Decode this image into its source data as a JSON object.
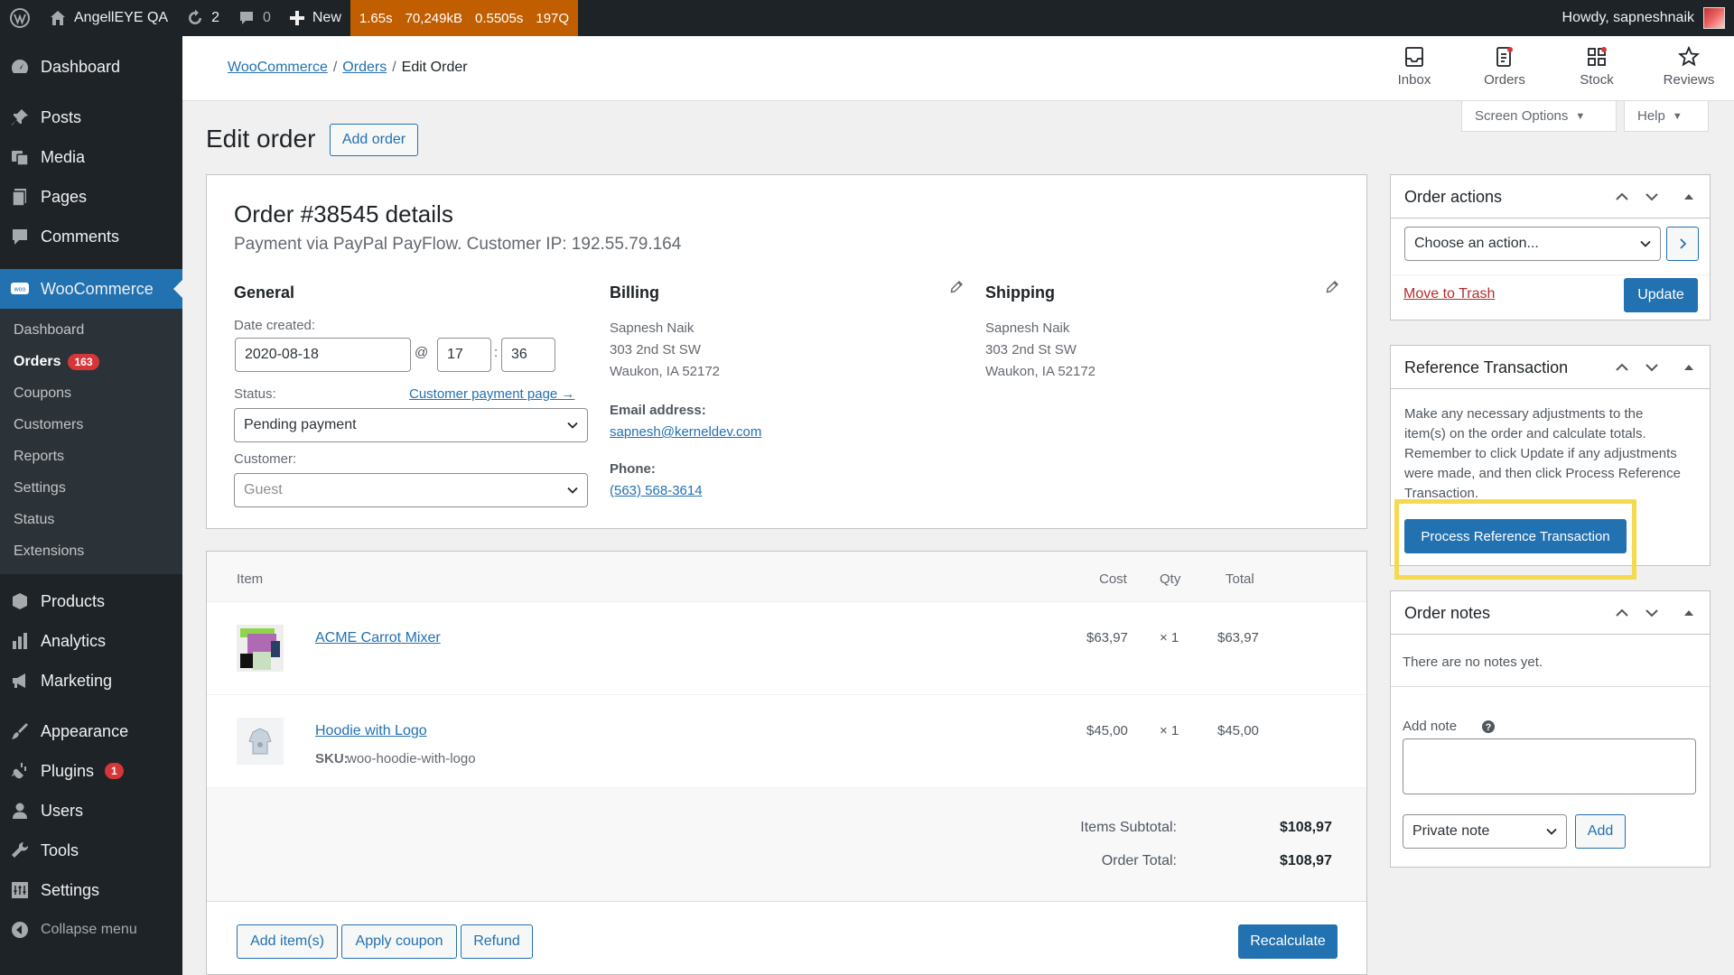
{
  "adminbar": {
    "site_name": "AngellEYE QA",
    "updates_count": "2",
    "comments_count": "0",
    "new_label": "New",
    "qm": [
      "1.65s",
      "70,249kB",
      "0.5505s",
      "197Q"
    ],
    "howdy": "Howdy, sapneshnaik"
  },
  "sidebar": {
    "items_top": [
      {
        "label": "Dashboard",
        "icon": "dashboard-icon"
      },
      {
        "label": "Posts",
        "icon": "pin-icon"
      },
      {
        "label": "Media",
        "icon": "media-icon"
      },
      {
        "label": "Pages",
        "icon": "pages-icon"
      },
      {
        "label": "Comments",
        "icon": "comment-icon"
      }
    ],
    "woocommerce": "WooCommerce",
    "submenu": [
      "Dashboard",
      "Orders",
      "Coupons",
      "Customers",
      "Reports",
      "Settings",
      "Status",
      "Extensions"
    ],
    "orders_badge": "163",
    "items_bottom": [
      {
        "label": "Products",
        "icon": "products-icon"
      },
      {
        "label": "Analytics",
        "icon": "analytics-icon"
      },
      {
        "label": "Marketing",
        "icon": "megaphone-icon"
      },
      {
        "label": "Appearance",
        "icon": "brush-icon"
      },
      {
        "label": "Plugins",
        "icon": "plug-icon"
      },
      {
        "label": "Users",
        "icon": "users-icon"
      },
      {
        "label": "Tools",
        "icon": "wrench-icon"
      },
      {
        "label": "Settings",
        "icon": "settings-icon"
      }
    ],
    "plugins_badge": "1",
    "collapse": "Collapse menu"
  },
  "header": {
    "breadcrumb": [
      "WooCommerce",
      "Orders",
      "Edit Order"
    ],
    "activity": [
      "Inbox",
      "Orders",
      "Stock",
      "Reviews"
    ],
    "screen_options": "Screen Options",
    "help": "Help"
  },
  "page": {
    "title": "Edit order",
    "add_order": "Add order"
  },
  "order": {
    "heading": "Order #38545 details",
    "subheading": "Payment via PayPal PayFlow. Customer IP: 192.55.79.164",
    "general": "General",
    "date_label": "Date created:",
    "date": "2020-08-18",
    "at": "@",
    "hour": "17",
    "colon": ":",
    "minute": "36",
    "status_label": "Status:",
    "customer_payment_link": "Customer payment page →",
    "status": "Pending payment",
    "customer_label": "Customer:",
    "customer": "Guest",
    "billing": {
      "title": "Billing",
      "name": "Sapnesh Naik",
      "street": "303 2nd St SW",
      "city": "Waukon, IA 52172",
      "email_label": "Email address:",
      "email": "sapnesh@kerneldev.com",
      "phone_label": "Phone:",
      "phone": "(563) 568-3614"
    },
    "shipping": {
      "title": "Shipping",
      "name": "Sapnesh Naik",
      "street": "303 2nd St SW",
      "city": "Waukon, IA 52172"
    }
  },
  "items": {
    "headers": {
      "item": "Item",
      "cost": "Cost",
      "qty": "Qty",
      "total": "Total"
    },
    "rows": [
      {
        "name": "ACME Carrot Mixer",
        "cost": "$63,97",
        "qty": "× 1",
        "total": "$63,97",
        "sku": ""
      },
      {
        "name": "Hoodie with Logo",
        "cost": "$45,00",
        "qty": "× 1",
        "total": "$45,00",
        "sku_label": "SKU:",
        "sku": "woo-hoodie-with-logo"
      }
    ],
    "subtotal_label": "Items Subtotal:",
    "subtotal": "$108,97",
    "total_label": "Order Total:",
    "total": "$108,97",
    "buttons": {
      "add_items": "Add item(s)",
      "apply_coupon": "Apply coupon",
      "refund": "Refund",
      "recalculate": "Recalculate"
    }
  },
  "order_actions": {
    "title": "Order actions",
    "select": "Choose an action...",
    "trash": "Move to Trash",
    "update": "Update"
  },
  "reference": {
    "title": "Reference Transaction",
    "text": "Make any necessary adjustments to the item(s) on the order and calculate totals. Remember to click Update if any adjustments were made, and then click Process Reference Transaction.",
    "button": "Process Reference Transaction"
  },
  "notes": {
    "title": "Order notes",
    "empty": "There are no notes yet.",
    "add_label": "Add note",
    "type": "Private note",
    "add_button": "Add"
  },
  "colors": {
    "accent": "#2271b1",
    "highlight": "#f5d94e",
    "adminbar": "#1d2327",
    "qm": "#c05e00"
  }
}
